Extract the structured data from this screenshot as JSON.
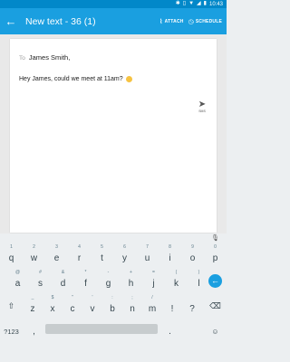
{
  "status_bar": {
    "time": "10:43",
    "icons": [
      "bluetooth-icon",
      "vibrate-icon",
      "wifi-icon",
      "signal-icon",
      "battery-icon"
    ]
  },
  "app_bar": {
    "title": "New text - 36 (1)",
    "attach_label": "ATTACH",
    "schedule_label": "SCHEDULE",
    "color": "#1a9fe0"
  },
  "compose": {
    "to_label": "To",
    "to_value": "James Smith,",
    "message": "Hey James, could we meet at 11am?",
    "send_label": "SMS"
  },
  "keyboard": {
    "row1": [
      {
        "c": "q",
        "h": "1"
      },
      {
        "c": "w",
        "h": "2"
      },
      {
        "c": "e",
        "h": "3"
      },
      {
        "c": "r",
        "h": "4"
      },
      {
        "c": "t",
        "h": "5"
      },
      {
        "c": "y",
        "h": "6"
      },
      {
        "c": "u",
        "h": "7"
      },
      {
        "c": "i",
        "h": "8"
      },
      {
        "c": "o",
        "h": "9"
      },
      {
        "c": "p",
        "h": "0"
      }
    ],
    "row2": [
      {
        "c": "a",
        "h": "@"
      },
      {
        "c": "s",
        "h": "#"
      },
      {
        "c": "d",
        "h": "&"
      },
      {
        "c": "f",
        "h": "*"
      },
      {
        "c": "g",
        "h": "-"
      },
      {
        "c": "h",
        "h": "+"
      },
      {
        "c": "j",
        "h": "="
      },
      {
        "c": "k",
        "h": "("
      },
      {
        "c": "l",
        "h": ")"
      }
    ],
    "row3": [
      {
        "c": "z",
        "h": "_"
      },
      {
        "c": "x",
        "h": "$"
      },
      {
        "c": "c",
        "h": "\""
      },
      {
        "c": "v",
        "h": "'"
      },
      {
        "c": "b",
        "h": ":"
      },
      {
        "c": "n",
        "h": ";"
      },
      {
        "c": "m",
        "h": "/"
      },
      {
        "c": "!",
        "h": ""
      },
      {
        "c": "?",
        "h": ""
      }
    ],
    "symbols_label": "?123",
    "comma_label": ",",
    "period_label": ".",
    "accent": "#1a9fe0"
  }
}
